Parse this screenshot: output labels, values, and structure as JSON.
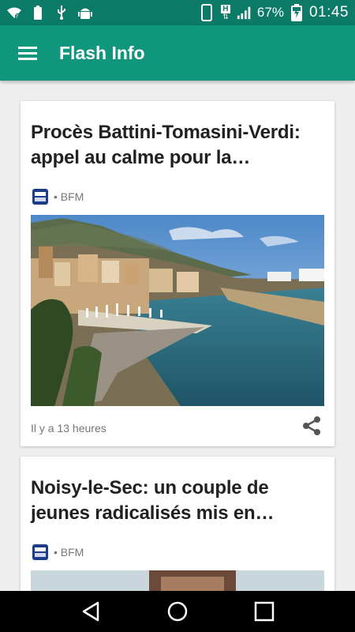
{
  "status_bar": {
    "battery_percent": "67%",
    "time": "01:45",
    "network_letter": "H",
    "icons": [
      "wifi-icon",
      "battery-full-icon",
      "usb-icon",
      "android-debug-icon",
      "phone-icon",
      "signal-icon",
      "battery-charging-icon"
    ]
  },
  "app_bar": {
    "title": "Flash Info",
    "menu_icon": "hamburger-menu-icon",
    "background": "#11967e"
  },
  "articles": [
    {
      "title": "Procès Battini-Tomasini-Verdi: appel au calme pour la…",
      "source": "• BFM",
      "time": "Il y a 13 heures",
      "share_icon": "share-icon"
    },
    {
      "title": "Noisy-le-Sec: un couple de jeunes radicalisés mis en…",
      "source": "• BFM"
    }
  ],
  "colors": {
    "status_bar": "#0b7a67",
    "accent": "#11967e",
    "card": "#ffffff",
    "background": "#eeeeee"
  },
  "nav_bar": {
    "icons": [
      "back-icon",
      "home-icon",
      "recents-icon"
    ]
  }
}
